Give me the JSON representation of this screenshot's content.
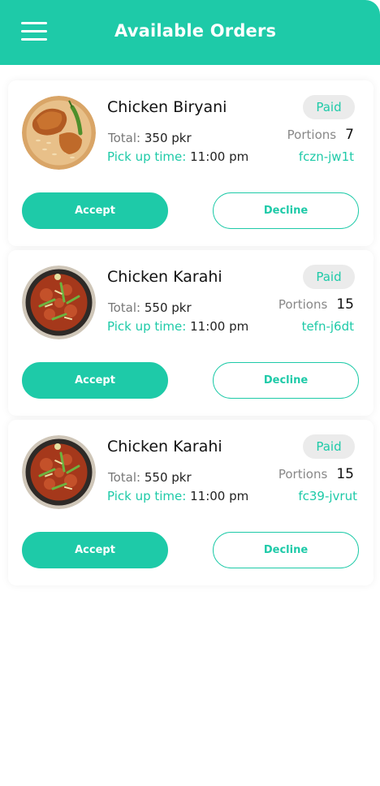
{
  "header": {
    "title": "Available Orders",
    "menu_icon": "hamburger-menu-icon"
  },
  "colors": {
    "accent": "#1ecaa8",
    "badge_bg": "#ebebeb"
  },
  "orders": [
    {
      "dish": "Chicken Biryani",
      "image": "biryani-dish-image",
      "total_label": "Total:",
      "total_value": "350 pkr",
      "pickup_label": "Pick up time:",
      "pickup_value": "11:00 pm",
      "status": "Paid",
      "portions_label": "Portions",
      "portions_value": "7",
      "code": "fczn-jw1t",
      "accept_label": "Accept",
      "decline_label": "Decline"
    },
    {
      "dish": "Chicken Karahi",
      "image": "karahi-dish-image",
      "total_label": "Total:",
      "total_value": "550 pkr",
      "pickup_label": "Pick up time:",
      "pickup_value": "11:00 pm",
      "status": "Paid",
      "portions_label": "Portions",
      "portions_value": "15",
      "code": "tefn-j6dt",
      "accept_label": "Accept",
      "decline_label": "Decline"
    },
    {
      "dish": "Chicken Karahi",
      "image": "karahi-dish-image",
      "total_label": "Total:",
      "total_value": "550 pkr",
      "pickup_label": "Pick up time:",
      "pickup_value": "11:00 pm",
      "status": "Paid",
      "portions_label": "Portions",
      "portions_value": "15",
      "code": "fc39-jvrut",
      "accept_label": "Accept",
      "decline_label": "Decline"
    }
  ]
}
